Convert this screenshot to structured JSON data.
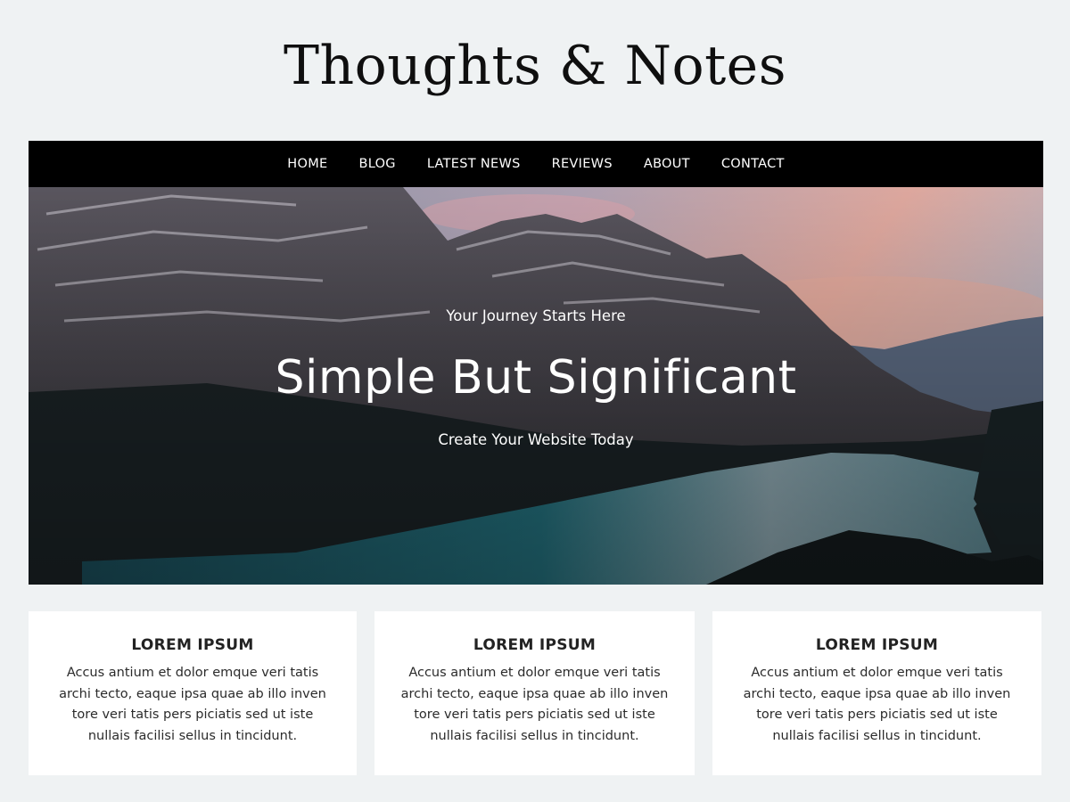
{
  "site": {
    "title": "Thoughts & Notes"
  },
  "nav": {
    "items": [
      {
        "label": "HOME"
      },
      {
        "label": "BLOG"
      },
      {
        "label": "LATEST NEWS"
      },
      {
        "label": "REVIEWS"
      },
      {
        "label": "ABOUT"
      },
      {
        "label": "CONTACT"
      }
    ]
  },
  "hero": {
    "kicker": "Your Journey Starts Here",
    "title": "Simple But Significant",
    "subtitle": "Create Your Website Today"
  },
  "cards": [
    {
      "title": "LOREM IPSUM",
      "lines": [
        "Accus antium et dolor emque veri tatis",
        "archi tecto, eaque ipsa quae ab illo inven",
        "tore veri tatis pers piciatis sed ut iste",
        "nullais facilisi sellus in tincidunt."
      ]
    },
    {
      "title": "LOREM IPSUM",
      "lines": [
        "Accus antium et dolor emque veri tatis",
        "archi tecto, eaque ipsa quae ab illo inven",
        "tore veri tatis pers piciatis sed ut iste",
        "nullais facilisi sellus in tincidunt."
      ]
    },
    {
      "title": "LOREM IPSUM",
      "lines": [
        "Accus antium et dolor emque veri tatis",
        "archi tecto, eaque ipsa quae ab illo inven",
        "tore veri tatis pers piciatis sed ut iste",
        "nullais facilisi sellus in tincidunt."
      ]
    }
  ]
}
